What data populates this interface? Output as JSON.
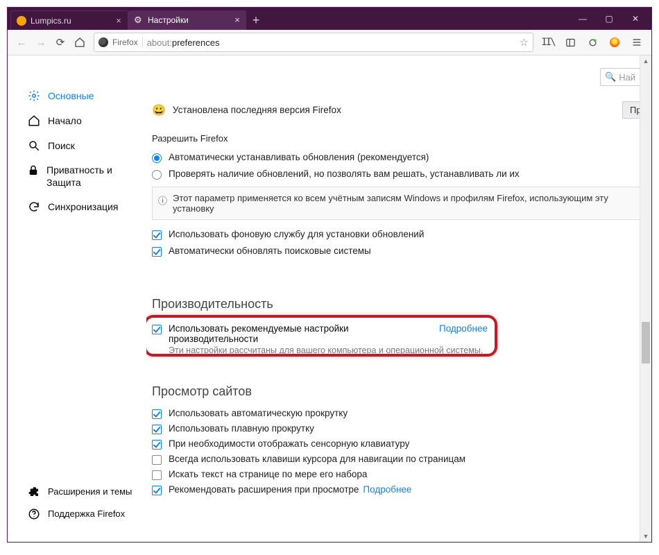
{
  "tabs": {
    "inactive": {
      "title": "Lumpics.ru"
    },
    "active": {
      "title": "Настройки"
    }
  },
  "urlbar": {
    "brand": "Firefox",
    "scheme": "about:",
    "path": "preferences"
  },
  "search": {
    "placeholder": "Най"
  },
  "sidebar": {
    "general": "Основные",
    "home": "Начало",
    "search": "Поиск",
    "privacy": "Приватность и Защита",
    "sync": "Синхронизация",
    "extensions": "Расширения и темы",
    "support": "Поддержка Firefox"
  },
  "version": {
    "text": "Установлена последняя версия Firefox",
    "button": "Провер"
  },
  "updates": {
    "allow_label": "Разрешить Firefox",
    "auto": "Автоматически устанавливать обновления (рекомендуется)",
    "check": "Проверять наличие обновлений, но позволять вам решать, устанавливать ли их",
    "info": "Этот параметр применяется ко всем учётным записям Windows и профилям Firefox, использующим эту установку",
    "bg_service": "Использовать фоновую службу для установки обновлений",
    "auto_engines": "Автоматически обновлять поисковые системы"
  },
  "perf": {
    "heading": "Производительность",
    "use_recommended": "Использовать рекомендуемые настройки производительности",
    "learn_more": "Подробнее",
    "note": "Эти настройки рассчитаны для вашего компьютера и операционной системы."
  },
  "browse": {
    "heading": "Просмотр сайтов",
    "autoscroll": "Использовать автоматическую прокрутку",
    "smoothscroll": "Использовать плавную прокрутку",
    "touch_kb": "При необходимости отображать сенсорную клавиатуру",
    "cursor_nav": "Всегда использовать клавиши курсора для навигации по страницам",
    "search_type": "Искать текст на странице по мере его набора",
    "recommend_ext": "Рекомендовать расширения при просмотре",
    "learn_more": "Подробнее"
  }
}
